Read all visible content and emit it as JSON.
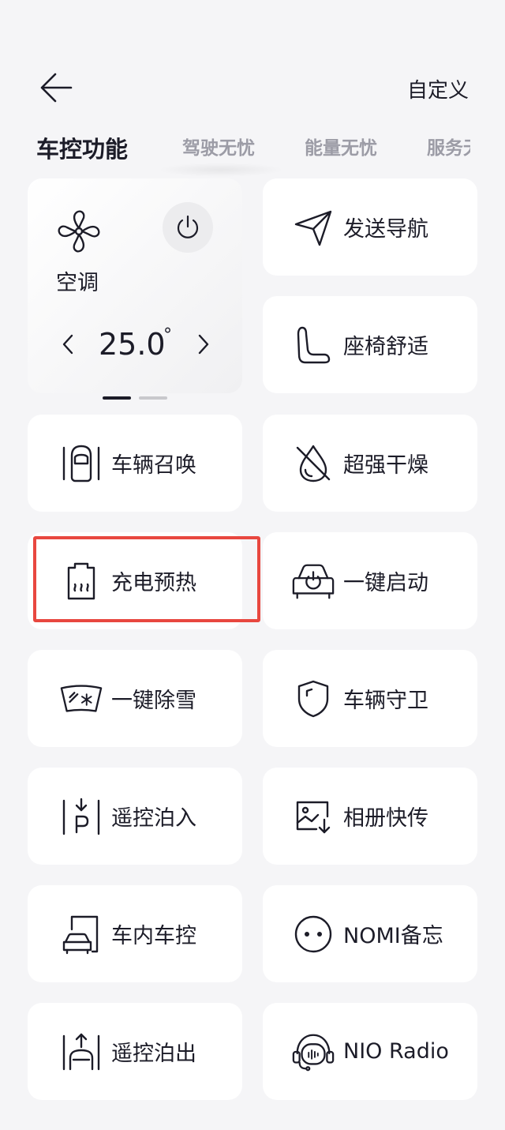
{
  "header": {
    "back_icon": "arrow-left-icon",
    "customize_label": "自定义"
  },
  "tabs": [
    {
      "label": "车控功能",
      "active": true
    },
    {
      "label": "驾驶无忧",
      "active": false
    },
    {
      "label": "能量无忧",
      "active": false
    },
    {
      "label": "服务无忧",
      "active": false
    }
  ],
  "ac": {
    "label": "空调",
    "temperature": "25.0",
    "unit": "°",
    "fan_icon": "fan-icon",
    "power_icon": "power-icon",
    "decrease_icon": "chevron-left-icon",
    "increase_icon": "chevron-right-icon"
  },
  "pager": {
    "current": 1,
    "total": 2
  },
  "cards": {
    "send_nav": {
      "label": "发送导航",
      "icon": "send-arrow-icon"
    },
    "seat_comfort": {
      "label": "座椅舒适",
      "icon": "seat-icon"
    },
    "vehicle_summon": {
      "label": "车辆召唤",
      "icon": "car-summon-icon"
    },
    "super_dry": {
      "label": "超强干燥",
      "icon": "droplet-off-icon"
    },
    "charge_preheat": {
      "label": "充电预热",
      "icon": "battery-heat-icon"
    },
    "one_key_start": {
      "label": "一键启动",
      "icon": "car-power-icon"
    },
    "snow_removal": {
      "label": "一键除雪",
      "icon": "windshield-snow-icon"
    },
    "vehicle_guard": {
      "label": "车辆守卫",
      "icon": "shield-icon"
    },
    "remote_park_in": {
      "label": "遥控泊入",
      "icon": "park-in-icon"
    },
    "album_transfer": {
      "label": "相册快传",
      "icon": "image-download-icon"
    },
    "in_car_control": {
      "label": "车内车控",
      "icon": "car-door-icon"
    },
    "nomi_memo": {
      "label": "NOMI备忘",
      "icon": "nomi-face-icon"
    },
    "remote_park_out": {
      "label": "遥控泊出",
      "icon": "park-out-icon"
    },
    "nio_radio": {
      "label": "NIO Radio",
      "icon": "radio-headset-icon"
    }
  },
  "highlight_color": "#e8473f"
}
